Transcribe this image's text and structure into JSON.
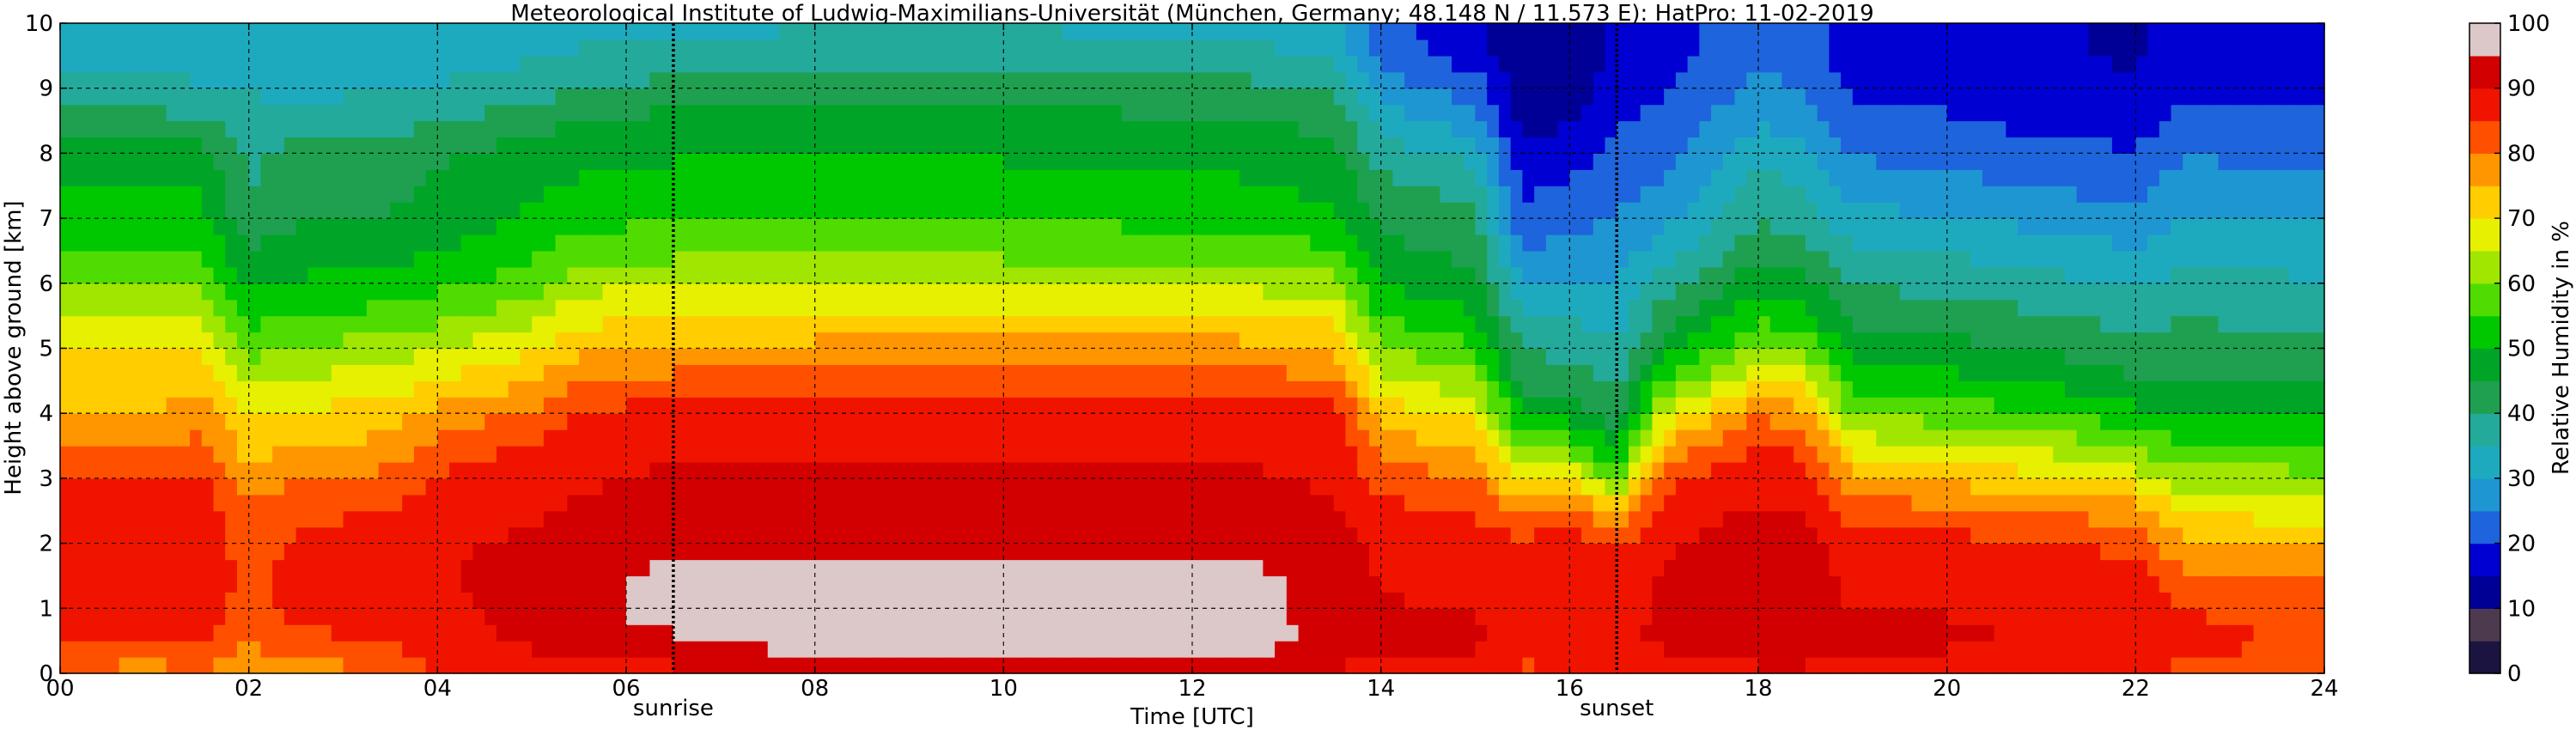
{
  "chart_data": {
    "type": "heatmap",
    "title": "Meteorological Institute of Ludwig-Maximilians-Universität (München, Germany; 48.148 N / 11.573 E):    HatPro: 11-02-2019",
    "xlabel": "Time [UTC]",
    "ylabel": "Height above ground [km]",
    "colorbar_label": "Relative Humidity in %",
    "xlim": [
      0,
      24
    ],
    "ylim": [
      0,
      10
    ],
    "x_ticks": [
      0,
      2,
      4,
      6,
      8,
      10,
      12,
      14,
      16,
      18,
      20,
      22,
      24
    ],
    "x_tick_labels": [
      "00",
      "02",
      "04",
      "06",
      "08",
      "10",
      "12",
      "14",
      "16",
      "18",
      "20",
      "22",
      "24"
    ],
    "y_ticks": [
      0,
      1,
      2,
      3,
      4,
      5,
      6,
      7,
      8,
      9,
      10
    ],
    "y_tick_labels": [
      "0",
      "1",
      "2",
      "3",
      "4",
      "5",
      "6",
      "7",
      "8",
      "9",
      "10"
    ],
    "colorbar_ticks": [
      0,
      10,
      20,
      30,
      40,
      50,
      60,
      70,
      80,
      90,
      100
    ],
    "colorbar_tick_labels": [
      "0",
      "10",
      "20",
      "30",
      "40",
      "50",
      "60",
      "70",
      "80",
      "90",
      "100"
    ],
    "grid": true,
    "colormap": [
      {
        "value": 0,
        "color": "#0a0a3c"
      },
      {
        "value": 5,
        "color": "#1c1440"
      },
      {
        "value": 10,
        "color": "#4e3a4e"
      },
      {
        "value": 15,
        "color": "#000096"
      },
      {
        "value": 20,
        "color": "#0000d2"
      },
      {
        "value": 25,
        "color": "#1e64dc"
      },
      {
        "value": 30,
        "color": "#1e96d2"
      },
      {
        "value": 35,
        "color": "#1eaabe"
      },
      {
        "value": 40,
        "color": "#23aa9b"
      },
      {
        "value": 45,
        "color": "#1ea050"
      },
      {
        "value": 50,
        "color": "#00a528"
      },
      {
        "value": 55,
        "color": "#00c800"
      },
      {
        "value": 60,
        "color": "#50dc00"
      },
      {
        "value": 65,
        "color": "#a0e600"
      },
      {
        "value": 70,
        "color": "#e6f000"
      },
      {
        "value": 75,
        "color": "#ffcd00"
      },
      {
        "value": 80,
        "color": "#ff9600"
      },
      {
        "value": 85,
        "color": "#ff5000"
      },
      {
        "value": 90,
        "color": "#f01400"
      },
      {
        "value": 95,
        "color": "#d20000"
      },
      {
        "value": 100,
        "color": "#dcc8c8"
      }
    ],
    "markers": [
      {
        "time": 6.5,
        "label": "sunrise"
      },
      {
        "time": 16.5,
        "label": "sunset"
      }
    ],
    "heights_km": [
      0.0,
      0.25,
      0.5,
      0.75,
      1.0,
      1.5,
      2.0,
      2.5,
      3.0,
      3.5,
      4.0,
      4.5,
      5.0,
      5.5,
      6.0,
      6.5,
      7.0,
      7.5,
      8.0,
      8.5,
      9.0,
      9.5,
      10.0
    ],
    "profiles": [
      {
        "time": 0.0,
        "rh": [
          82,
          85,
          87,
          88,
          89,
          90,
          91,
          91,
          88,
          82,
          78,
          75,
          72,
          68,
          62,
          58,
          55,
          53,
          50,
          45,
          40,
          36,
          35
        ]
      },
      {
        "time": 1.0,
        "rh": [
          80,
          84,
          87,
          88,
          89,
          90,
          90,
          90,
          87,
          81,
          78,
          75,
          72,
          67,
          62,
          58,
          55,
          52,
          50,
          44,
          39,
          36,
          35
        ]
      },
      {
        "time": 1.5,
        "rh": [
          82,
          85,
          88,
          89,
          90,
          91,
          91,
          91,
          89,
          84,
          80,
          76,
          73,
          67,
          61,
          57,
          54,
          52,
          49,
          43,
          38,
          35,
          34
        ]
      },
      {
        "time": 2.0,
        "rh": [
          78,
          80,
          83,
          84,
          85,
          86,
          85,
          83,
          80,
          75,
          72,
          66,
          60,
          56,
          52,
          48,
          44,
          42,
          42,
          40,
          37,
          34,
          33
        ]
      },
      {
        "time": 2.5,
        "rh": [
          80,
          83,
          86,
          88,
          89,
          89,
          88,
          86,
          82,
          77,
          73,
          68,
          63,
          57,
          53,
          50,
          47,
          45,
          44,
          40,
          36,
          34,
          33
        ]
      },
      {
        "time": 3.5,
        "rh": [
          82,
          85,
          88,
          89,
          90,
          90,
          90,
          88,
          84,
          79,
          75,
          70,
          65,
          59,
          55,
          51,
          48,
          46,
          45,
          41,
          37,
          35,
          34
        ]
      },
      {
        "time": 4.0,
        "rh": [
          87,
          90,
          91,
          92,
          92,
          92,
          92,
          91,
          88,
          84,
          79,
          73,
          67,
          61,
          56,
          52,
          50,
          48,
          47,
          42,
          38,
          35,
          34
        ]
      },
      {
        "time": 5.0,
        "rh": [
          90,
          92,
          93,
          93,
          93,
          94,
          93,
          92,
          91,
          88,
          83,
          77,
          72,
          66,
          60,
          56,
          53,
          52,
          50,
          45,
          40,
          37,
          35
        ]
      },
      {
        "time": 5.5,
        "rh": [
          91,
          93,
          96,
          97,
          97,
          97,
          96,
          93,
          92,
          91,
          88,
          82,
          76,
          71,
          66,
          60,
          56,
          53,
          51,
          48,
          43,
          38,
          36
        ]
      },
      {
        "time": 6.5,
        "rh": [
          91,
          94,
          97,
          98,
          98,
          98,
          97,
          94,
          93,
          92,
          90,
          84,
          78,
          72,
          67,
          61,
          57,
          54,
          52,
          49,
          44,
          39,
          36
        ]
      },
      {
        "time": 8.0,
        "rh": [
          91,
          98,
          99,
          98,
          98,
          98,
          97,
          94,
          93,
          92,
          91,
          85,
          79,
          73,
          67,
          61,
          57,
          54,
          52,
          49,
          44,
          40,
          37
        ]
      },
      {
        "time": 10.0,
        "rh": [
          91,
          99,
          99,
          99,
          98,
          98,
          97,
          94,
          93,
          92,
          91,
          85,
          79,
          73,
          67,
          61,
          57,
          54,
          52,
          49,
          45,
          40,
          37
        ]
      },
      {
        "time": 12.5,
        "rh": [
          91,
          98,
          99,
          98,
          98,
          98,
          97,
          94,
          93,
          92,
          91,
          85,
          79,
          73,
          66,
          60,
          56,
          53,
          51,
          48,
          44,
          39,
          36
        ]
      },
      {
        "time": 13.5,
        "rh": [
          91,
          95,
          97,
          97,
          97,
          97,
          96,
          93,
          92,
          91,
          90,
          83,
          77,
          71,
          65,
          58,
          54,
          51,
          49,
          46,
          42,
          37,
          35
        ]
      },
      {
        "time": 14.0,
        "rh": [
          90,
          92,
          93,
          93,
          93,
          92,
          91,
          89,
          85,
          80,
          75,
          69,
          63,
          57,
          52,
          49,
          47,
          44,
          40,
          35,
          30,
          26,
          25
        ]
      },
      {
        "time": 15.0,
        "rh": [
          90,
          92,
          93,
          93,
          92,
          91,
          90,
          87,
          83,
          77,
          71,
          64,
          58,
          53,
          49,
          46,
          43,
          40,
          36,
          30,
          25,
          20,
          18
        ]
      },
      {
        "time": 15.5,
        "rh": [
          86,
          88,
          90,
          91,
          91,
          90,
          89,
          80,
          70,
          60,
          52,
          46,
          42,
          38,
          33,
          28,
          24,
          21,
          18,
          16,
          15,
          14,
          14
        ]
      },
      {
        "time": 16.0,
        "rh": [
          88,
          90,
          92,
          92,
          92,
          92,
          91,
          85,
          72,
          60,
          51,
          45,
          41,
          37,
          33,
          29,
          26,
          23,
          20,
          17,
          15,
          14,
          14
        ]
      },
      {
        "time": 16.5,
        "rh": [
          90,
          91,
          92,
          92,
          91,
          90,
          86,
          76,
          60,
          51,
          45,
          41,
          38,
          35,
          33,
          30,
          28,
          26,
          24,
          22,
          20,
          18,
          18
        ]
      },
      {
        "time": 17.0,
        "rh": [
          91,
          92,
          93,
          93,
          93,
          93,
          92,
          90,
          86,
          78,
          68,
          58,
          50,
          45,
          40,
          35,
          31,
          28,
          26,
          24,
          22,
          20,
          20
        ]
      },
      {
        "time": 18.0,
        "rh": [
          91,
          94,
          96,
          96,
          96,
          96,
          95,
          93,
          91,
          88,
          82,
          72,
          63,
          56,
          51,
          46,
          42,
          39,
          36,
          32,
          29,
          27,
          26
        ]
      },
      {
        "time": 18.5,
        "rh": [
          91,
          94,
          96,
          96,
          96,
          96,
          95,
          92,
          90,
          86,
          79,
          70,
          61,
          54,
          49,
          44,
          40,
          37,
          34,
          30,
          27,
          25,
          24
        ]
      },
      {
        "time": 19.0,
        "rh": [
          90,
          92,
          93,
          93,
          92,
          91,
          89,
          85,
          78,
          70,
          62,
          55,
          50,
          46,
          42,
          38,
          34,
          30,
          27,
          24,
          22,
          20,
          20
        ]
      },
      {
        "time": 20.0,
        "rh": [
          90,
          92,
          93,
          93,
          92,
          91,
          89,
          84,
          76,
          68,
          60,
          54,
          49,
          45,
          41,
          37,
          33,
          29,
          26,
          23,
          21,
          19,
          19
        ]
      },
      {
        "time": 21.0,
        "rh": [
          89,
          91,
          92,
          92,
          91,
          90,
          88,
          82,
          74,
          66,
          58,
          52,
          47,
          43,
          39,
          35,
          31,
          27,
          24,
          21,
          19,
          18,
          18
        ]
      },
      {
        "time": 22.0,
        "rh": [
          89,
          91,
          92,
          92,
          91,
          89,
          86,
          80,
          70,
          61,
          54,
          48,
          44,
          41,
          37,
          33,
          29,
          26,
          23,
          20,
          18,
          17,
          17
        ]
      },
      {
        "time": 22.5,
        "rh": [
          86,
          88,
          89,
          89,
          87,
          84,
          78,
          72,
          65,
          58,
          52,
          48,
          45,
          42,
          39,
          36,
          33,
          30,
          27,
          24,
          21,
          19,
          19
        ]
      },
      {
        "time": 24.0,
        "rh": [
          85,
          86,
          86,
          86,
          85,
          82,
          76,
          70,
          64,
          57,
          51,
          47,
          44,
          41,
          38,
          35,
          32,
          29,
          26,
          23,
          21,
          19,
          19
        ]
      }
    ]
  }
}
